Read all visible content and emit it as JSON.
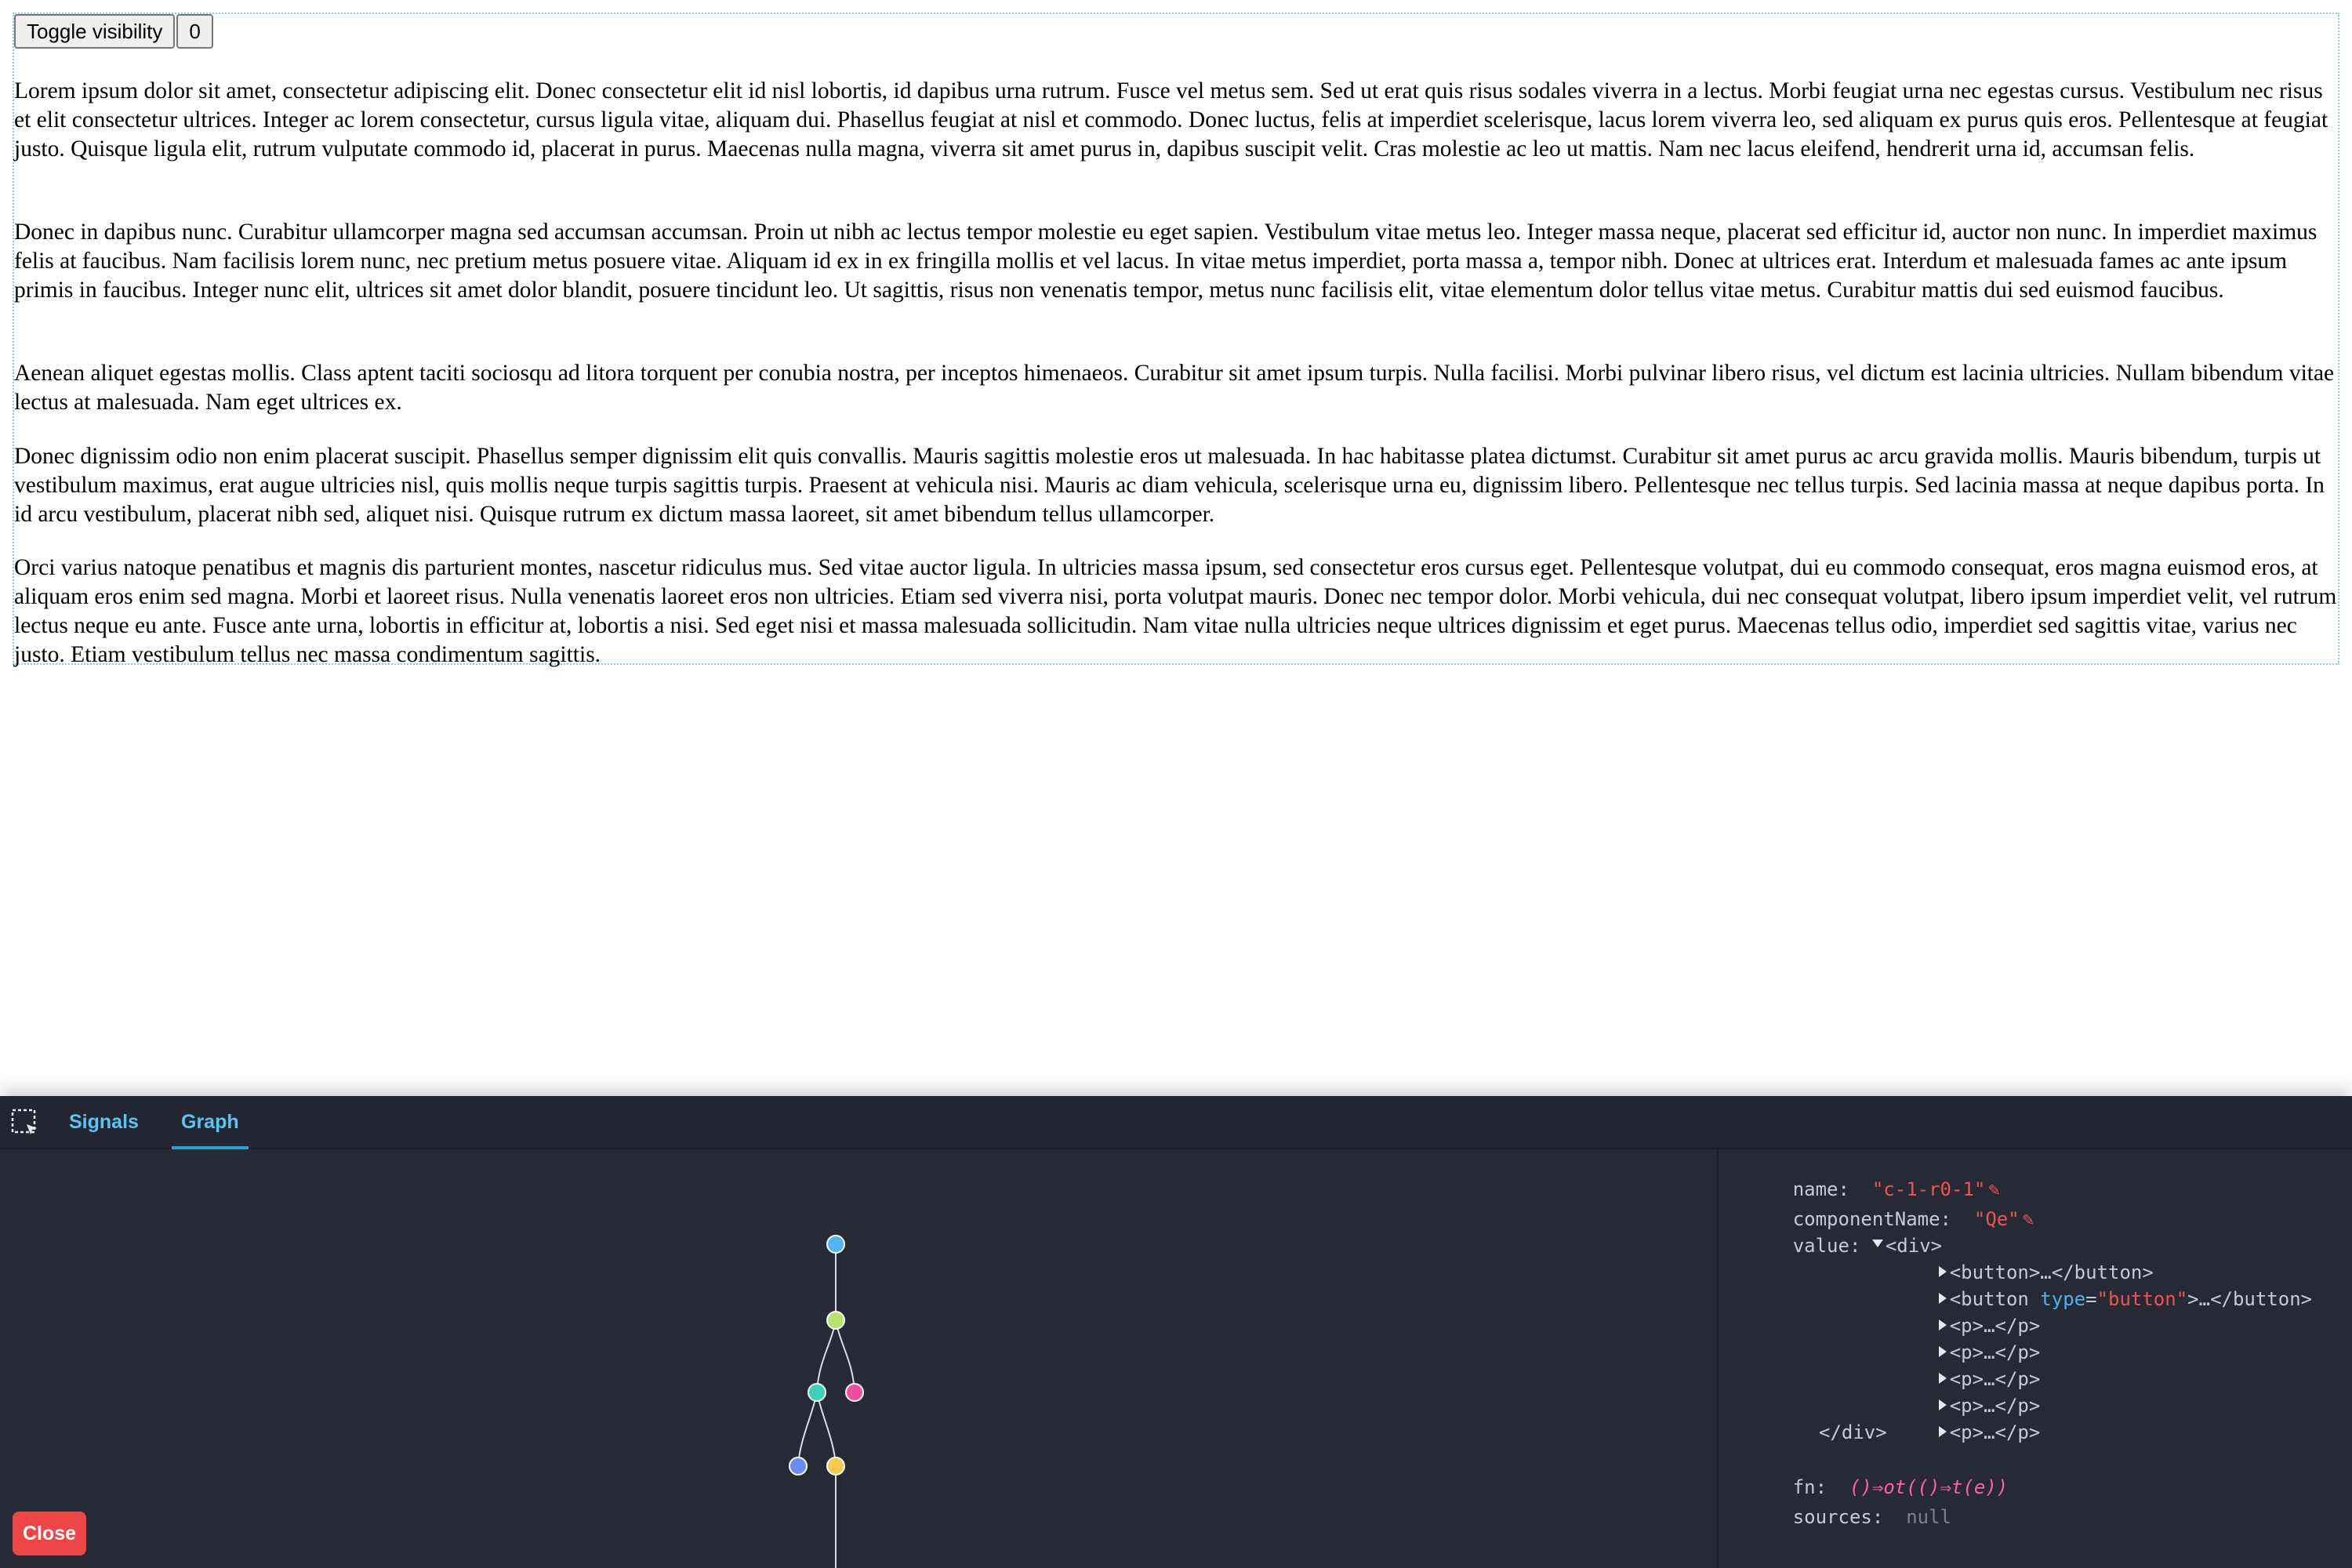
{
  "page": {
    "toggle_label": "Toggle visibility",
    "counter_label": "0",
    "paragraphs": [
      "Lorem ipsum dolor sit amet, consectetur adipiscing elit. Donec consectetur elit id nisl lobortis, id dapibus urna rutrum. Fusce vel metus sem. Sed ut erat quis risus sodales viverra in a lectus. Morbi feugiat urna nec egestas cursus. Vestibulum nec risus et elit consectetur ultrices. Integer ac lorem consectetur, cursus ligula vitae, aliquam dui. Phasellus feugiat at nisl et commodo. Donec luctus, felis at imperdiet scelerisque, lacus lorem viverra leo, sed aliquam ex purus quis eros. Pellentesque at feugiat justo. Quisque ligula elit, rutrum vulputate commodo id, placerat in purus. Maecenas nulla magna, viverra sit amet purus in, dapibus suscipit velit. Cras molestie ac leo ut mattis. Nam nec lacus eleifend, hendrerit urna id, accumsan felis.",
      "Donec in dapibus nunc. Curabitur ullamcorper magna sed accumsan accumsan. Proin ut nibh ac lectus tempor molestie eu eget sapien. Vestibulum vitae metus leo. Integer massa neque, placerat sed efficitur id, auctor non nunc. In imperdiet maximus felis at faucibus. Nam facilisis lorem nunc, nec pretium metus posuere vitae. Aliquam id ex in ex fringilla mollis et vel lacus. In vitae metus imperdiet, porta massa a, tempor nibh. Donec at ultrices erat. Interdum et malesuada fames ac ante ipsum primis in faucibus. Integer nunc elit, ultrices sit amet dolor blandit, posuere tincidunt leo. Ut sagittis, risus non venenatis tempor, metus nunc facilisis elit, vitae elementum dolor tellus vitae metus. Curabitur mattis dui sed euismod faucibus.",
      "Aenean aliquet egestas mollis. Class aptent taciti sociosqu ad litora torquent per conubia nostra, per inceptos himenaeos. Curabitur sit amet ipsum turpis. Nulla facilisi. Morbi pulvinar libero risus, vel dictum est lacinia ultricies. Nullam bibendum vitae lectus at malesuada. Nam eget ultrices ex.",
      "Donec dignissim odio non enim placerat suscipit. Phasellus semper dignissim elit quis convallis. Mauris sagittis molestie eros ut malesuada. In hac habitasse platea dictumst. Curabitur sit amet purus ac arcu gravida mollis. Mauris bibendum, turpis ut vestibulum maximus, erat augue ultricies nisl, quis mollis neque turpis sagittis turpis. Praesent at vehicula nisi. Mauris ac diam vehicula, scelerisque urna eu, dignissim libero. Pellentesque nec tellus turpis. Sed lacinia massa at neque dapibus porta. In id arcu vestibulum, placerat nibh sed, aliquet nisi. Quisque rutrum ex dictum massa laoreet, sit amet bibendum tellus ullamcorper.",
      "Orci varius natoque penatibus et magnis dis parturient montes, nascetur ridiculus mus. Sed vitae auctor ligula. In ultricies massa ipsum, sed consectetur eros cursus eget. Pellentesque volutpat, dui eu commodo consequat, eros magna euismod eros, at aliquam eros enim sed magna. Morbi et laoreet risus. Nulla venenatis laoreet eros non ultricies. Etiam sed viverra nisi, porta volutpat mauris. Donec nec tempor dolor. Morbi vehicula, dui nec consequat volutpat, libero ipsum imperdiet velit, vel rutrum lectus neque eu ante. Fusce ante urna, lobortis in efficitur at, lobortis a nisi. Sed eget nisi et massa malesuada sollicitudin. Nam vitae nulla ultricies neque ultrices dignissim et eget purus. Maecenas tellus odio, imperdiet sed sagittis vitae, varius nec justo. Etiam vestibulum tellus nec massa condimentum sagittis."
    ]
  },
  "devtools": {
    "inspect_icon": "select-element-icon",
    "tabs": [
      {
        "label": "Signals",
        "active": false
      },
      {
        "label": "Graph",
        "active": true
      }
    ],
    "close_label": "Close",
    "graph": {
      "node_colors": [
        "#4fb6ef",
        "#b6e36b",
        "#3fd0b8",
        "#ef4f9a",
        "#6a8cf0",
        "#f7c94c"
      ],
      "edge_color": "#d8dce4"
    },
    "inspector": {
      "name_key": "name:",
      "name_value": "\"c-1-r0-1\"",
      "component_key": "componentName:",
      "component_value": "\"Qe\"",
      "value_key": "value:",
      "root_open": "<div>",
      "children": [
        {
          "open": "<button>",
          "ellipsis": "…",
          "close": "</button>"
        },
        {
          "open_start": "<button",
          "attr_name": "type",
          "attr_eq": "=",
          "attr_value": "\"button\"",
          "open_end": ">",
          "ellipsis": "…",
          "close": "</button>"
        },
        {
          "open": "<p>",
          "ellipsis": "…",
          "close": "</p>"
        },
        {
          "open": "<p>",
          "ellipsis": "…",
          "close": "</p>"
        },
        {
          "open": "<p>",
          "ellipsis": "…",
          "close": "</p>"
        },
        {
          "open": "<p>",
          "ellipsis": "…",
          "close": "</p>"
        },
        {
          "open": "<p>",
          "ellipsis": "…",
          "close": "</p>"
        }
      ],
      "root_close": "</div>",
      "fn_key": "fn:",
      "fn_value": "()⇒ot(()⇒t(e))",
      "sources_key": "sources:",
      "sources_value": "null",
      "edit_icon": "pencil-icon"
    }
  }
}
